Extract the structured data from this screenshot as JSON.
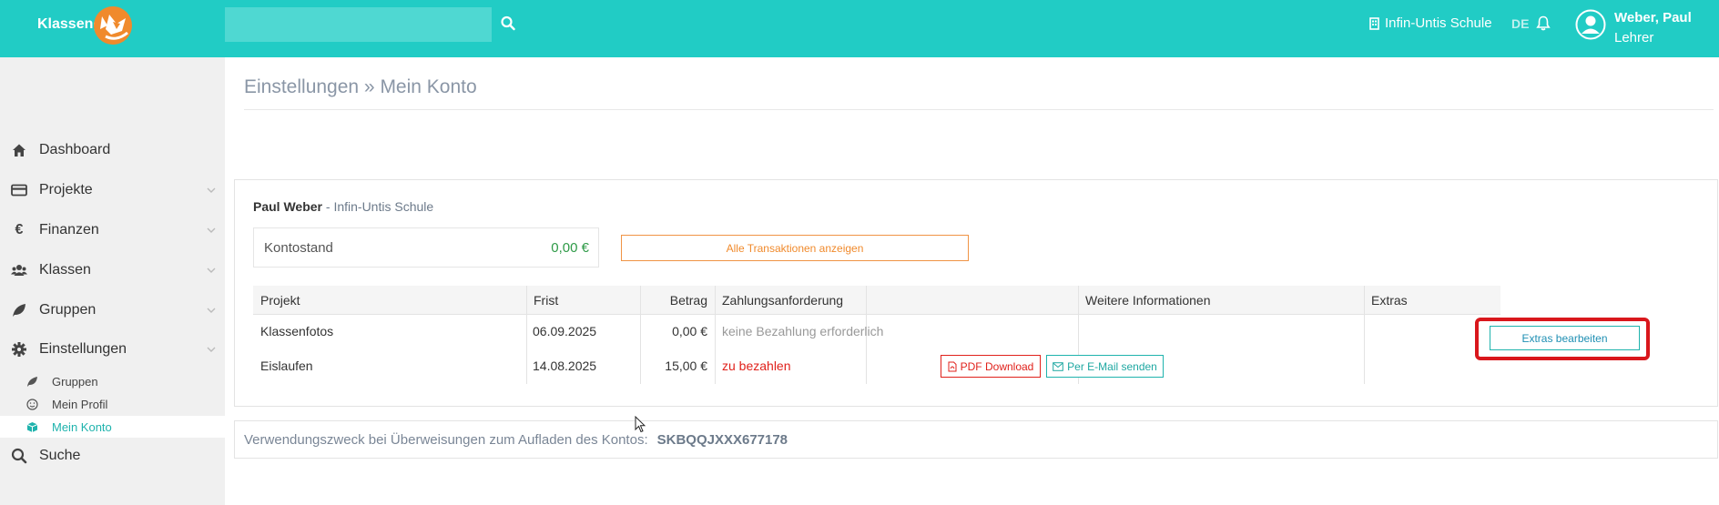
{
  "header": {
    "brand": "Klassengeld",
    "search": {
      "value": "",
      "placeholder": ""
    },
    "school": "Infin-Untis Schule",
    "language": "DE",
    "user": {
      "name": "Weber, Paul",
      "role": "Lehrer"
    }
  },
  "sidebar": {
    "items": [
      {
        "label": "Dashboard",
        "icon": "home-icon"
      },
      {
        "label": "Projekte",
        "icon": "credit-card-icon"
      },
      {
        "label": "Finanzen",
        "icon": "euro-icon"
      },
      {
        "label": "Klassen",
        "icon": "users-icon"
      },
      {
        "label": "Gruppen",
        "icon": "leaf-icon"
      },
      {
        "label": "Einstellungen",
        "icon": "gear-icon"
      }
    ],
    "subitems": [
      {
        "label": "Gruppen",
        "icon": "leaf-icon"
      },
      {
        "label": "Mein Profil",
        "icon": "smile-icon"
      },
      {
        "label": "Mein Konto",
        "icon": "cube-icon",
        "active": true
      }
    ],
    "search_label": "Suche"
  },
  "page": {
    "title": "Einstellungen » Mein Konto"
  },
  "account": {
    "owner_name": "Paul Weber",
    "owner_school": " - Infin-Untis Schule",
    "balance_label": "Kontostand",
    "balance_value": "0,00 €",
    "all_transactions_label": "Alle Transaktionen anzeigen"
  },
  "table": {
    "headers": [
      "Projekt",
      "Frist",
      "Betrag",
      "Zahlungsanforderung",
      "",
      "Weitere Informationen",
      "Extras"
    ],
    "rows": [
      {
        "project": "Klassenfotos",
        "deadline": "06.09.2025",
        "amount": "0,00 €",
        "status": "keine Bezahlung erforderlich"
      },
      {
        "project": "Eislaufen",
        "deadline": "14.08.2025",
        "amount": "15,00 €",
        "status": "zu bezahlen"
      }
    ],
    "pdf_button": "PDF Download",
    "email_button": "Per E-Mail senden",
    "extras_button": "Extras bearbeiten"
  },
  "reference": {
    "label": "Verwendungszweck bei Überweisungen zum Aufladen des Kontos:",
    "code": "SKBQQJXXX677178"
  },
  "colors": {
    "header": "#21ccc5",
    "accent": "#1fb3ad",
    "orange": "#f08a2c",
    "danger": "#e0211b",
    "success": "#2e9a47",
    "highlight": "#d9171c"
  }
}
